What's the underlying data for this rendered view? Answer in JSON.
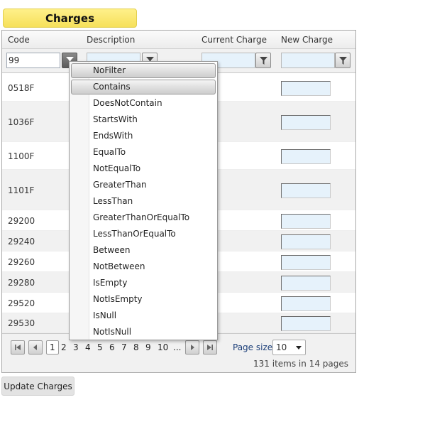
{
  "title": "Charges",
  "columns": {
    "code": "Code",
    "description": "Description",
    "current_charge": "Current Charge",
    "new_charge": "New Charge"
  },
  "filter": {
    "code_value": "99"
  },
  "rows": [
    {
      "code": "0518F"
    },
    {
      "code": "1036F"
    },
    {
      "code": "1100F"
    },
    {
      "code": "1101F"
    },
    {
      "code": "29200"
    },
    {
      "code": "29240"
    },
    {
      "code": "29260"
    },
    {
      "code": "29280"
    },
    {
      "code": "29520"
    },
    {
      "code": "29530"
    }
  ],
  "filter_menu": {
    "items": [
      "NoFilter",
      "Contains",
      "DoesNotContain",
      "StartsWith",
      "EndsWith",
      "EqualTo",
      "NotEqualTo",
      "GreaterThan",
      "LessThan",
      "GreaterThanOrEqualTo",
      "LessThanOrEqualTo",
      "Between",
      "NotBetween",
      "IsEmpty",
      "NotIsEmpty",
      "IsNull",
      "NotIsNull"
    ]
  },
  "pager": {
    "pages": [
      "1",
      "2",
      "3",
      "4",
      "5",
      "6",
      "7",
      "8",
      "9",
      "10",
      "..."
    ],
    "current_page": "1",
    "page_size_label": "Page size:",
    "page_size": "10",
    "info": "131 items in 14 pages"
  },
  "update_button": "Update Charges",
  "colors": {
    "title_bg": "#f6e05a",
    "input_bg": "#e6f2fb",
    "alt_row": "#f1f1f1"
  }
}
